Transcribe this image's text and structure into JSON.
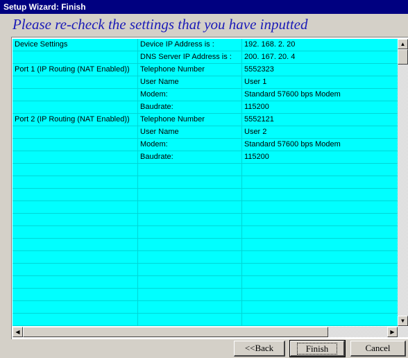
{
  "window": {
    "title": "Setup Wizard: Finish",
    "heading": "Please re-check the settings that you have inputted"
  },
  "grid": {
    "rows": [
      [
        "Device Settings",
        "Device IP Address is :",
        " 192. 168. 2. 20"
      ],
      [
        "",
        "DNS Server IP Address is :",
        " 200. 167. 20. 4"
      ],
      [
        "Port  1 (IP Routing (NAT Enabled))",
        "Telephone Number",
        "5552323"
      ],
      [
        "",
        "User Name",
        "User 1"
      ],
      [
        "",
        "Modem:",
        "Standard 57600 bps Modem"
      ],
      [
        "",
        "Baudrate:",
        " 115200"
      ],
      [
        "Port  2 (IP Routing (NAT Enabled))",
        "Telephone Number",
        "5552121"
      ],
      [
        "",
        "User Name",
        "User 2"
      ],
      [
        "",
        "Modem:",
        "Standard 57600 bps Modem"
      ],
      [
        "",
        "Baudrate:",
        " 115200"
      ],
      [
        "",
        "",
        ""
      ],
      [
        "",
        "",
        ""
      ],
      [
        "",
        "",
        ""
      ],
      [
        "",
        "",
        ""
      ],
      [
        "",
        "",
        ""
      ],
      [
        "",
        "",
        ""
      ],
      [
        "",
        "",
        ""
      ],
      [
        "",
        "",
        ""
      ],
      [
        "",
        "",
        ""
      ],
      [
        "",
        "",
        ""
      ],
      [
        "",
        "",
        ""
      ],
      [
        "",
        "",
        ""
      ],
      [
        "",
        "",
        ""
      ]
    ]
  },
  "buttons": {
    "back": "<<Back",
    "finish": "Finish",
    "cancel": "Cancel"
  },
  "colors": {
    "title_bar": "#000080",
    "grid_background": "#00ffff",
    "heading_text": "#1a1ab8",
    "dialog_face": "#d4d0c8"
  },
  "icons": {
    "scroll_up": "triangle-up",
    "scroll_down": "triangle-down",
    "scroll_left": "triangle-left",
    "scroll_right": "triangle-right"
  }
}
